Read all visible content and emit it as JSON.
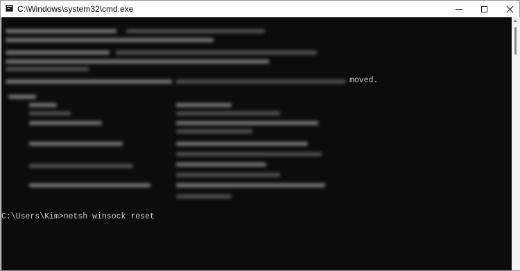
{
  "window": {
    "title": "C:\\Windows\\system32\\cmd.exe",
    "icon": "console-app-icon",
    "controls": [
      "minimize-icon",
      "maximize-icon",
      "close-icon"
    ]
  },
  "console": {
    "visible_fragment": "moved.",
    "prompt": "C:\\Users\\Kim>",
    "command": "netsh winsock reset"
  },
  "colors": {
    "console_background": "#0c0c0c",
    "console_text": "#cccccc",
    "titlebar": "#ffffff"
  }
}
